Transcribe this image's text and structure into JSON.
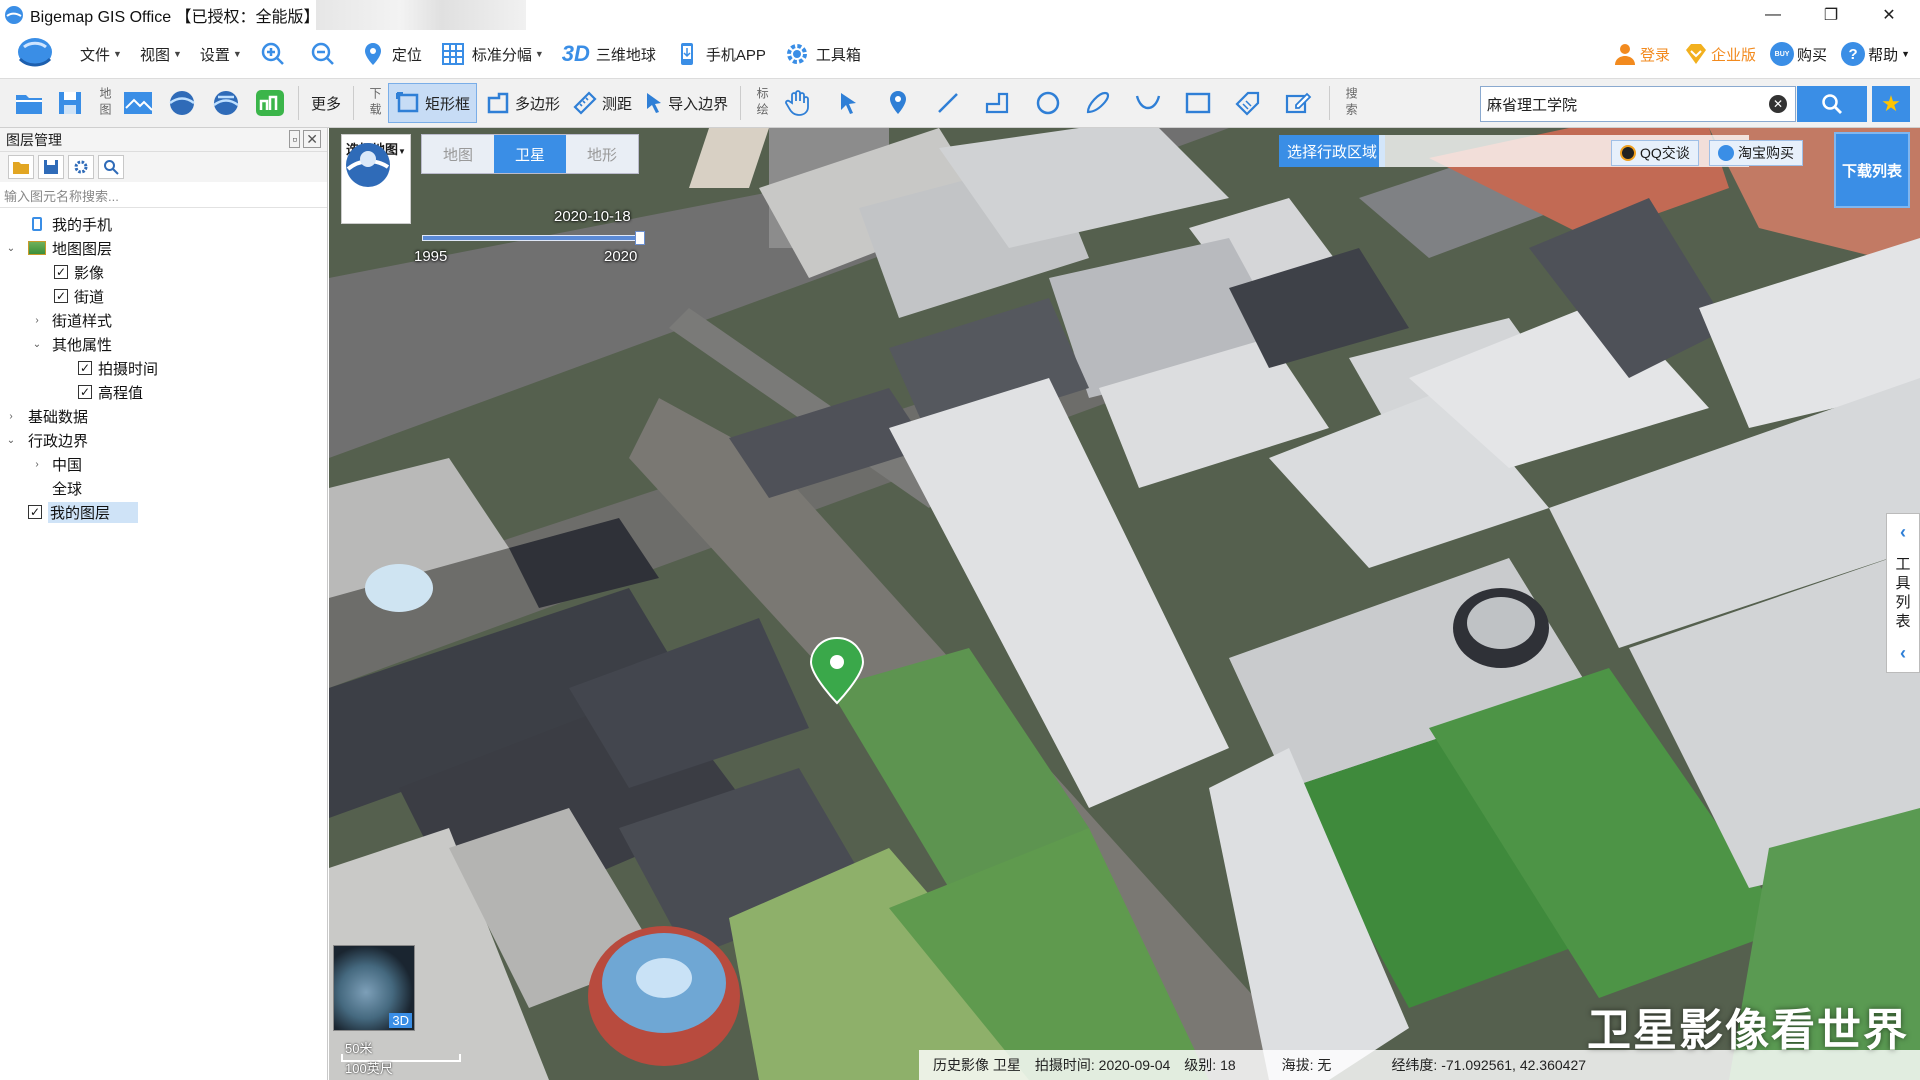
{
  "window": {
    "title": "Bigemap GIS Office 【已授权：全能版】",
    "controls": {
      "minimize": "—",
      "restore": "❐",
      "close": "✕"
    }
  },
  "menubar": {
    "items": [
      {
        "label": "文件",
        "has_caret": true
      },
      {
        "label": "视图",
        "has_caret": true
      },
      {
        "label": "设置",
        "has_caret": true
      }
    ],
    "zoom_in_icon": "zoom-in-icon",
    "zoom_out_icon": "zoom-out-icon",
    "locate": "定位",
    "standard_grid": "标准分幅",
    "three_d_logo": "3D",
    "globe": "三维地球",
    "mobile_app": "手机APP",
    "toolbox": "工具箱",
    "right": {
      "login": "登录",
      "enterprise": "企业版",
      "buy": "购买",
      "buy_badge": "BUY",
      "help": "帮助"
    },
    "accent": "#3a8ee6",
    "orange": "#f28a1e"
  },
  "toolbar": {
    "group_map_label": "地图",
    "more": "更多",
    "group_download_label": "下载",
    "rect": "矩形框",
    "polygon": "多边形",
    "measure": "测距",
    "import_boundary": "导入边界",
    "group_draw_label": "标绘",
    "group_search_label": "搜索",
    "search_value": "麻省理工学院",
    "search_placeholder": ""
  },
  "panel": {
    "title": "图层管理",
    "search_placeholder": "输入图元名称搜索...",
    "tree": [
      {
        "label": "我的手机",
        "level": 1,
        "arrow": "",
        "checkbox": null,
        "icon": "phone-icon"
      },
      {
        "label": "地图图层",
        "level": 0,
        "arrow": "⌄",
        "checkbox": null,
        "icon": "layers-icon"
      },
      {
        "label": "影像",
        "level": 2,
        "arrow": "",
        "checkbox": true
      },
      {
        "label": "街道",
        "level": 2,
        "arrow": "",
        "checkbox": true
      },
      {
        "label": "街道样式",
        "level": 1,
        "arrow": "›",
        "checkbox": null
      },
      {
        "label": "其他属性",
        "level": 1,
        "arrow": "⌄",
        "checkbox": null
      },
      {
        "label": "拍摄时间",
        "level": 3,
        "arrow": "",
        "checkbox": true
      },
      {
        "label": "高程值",
        "level": 3,
        "arrow": "",
        "checkbox": true
      },
      {
        "label": "基础数据",
        "level": 0,
        "arrow": "›",
        "checkbox": null
      },
      {
        "label": "行政边界",
        "level": 0,
        "arrow": "⌄",
        "checkbox": null
      },
      {
        "label": "中国",
        "level": 1,
        "arrow": "›",
        "checkbox": null
      },
      {
        "label": "全球",
        "level": 1,
        "arrow": "",
        "checkbox": null
      },
      {
        "label": "我的图层",
        "level": 1,
        "arrow": "",
        "checkbox": true,
        "selected": true
      }
    ]
  },
  "map": {
    "select_map_label": "选择地图",
    "tabs": [
      {
        "label": "地图",
        "active": false
      },
      {
        "label": "卫星",
        "active": true
      },
      {
        "label": "地形",
        "active": false
      }
    ],
    "timeline": {
      "current_date": "2020-10-18",
      "start_year": "1995",
      "end_year": "2020"
    },
    "region_button": "选择行政区域",
    "qq_button": "QQ交谈",
    "taobao_button": "淘宝购买",
    "download_list": "下载列表",
    "side_tools_label": [
      "工",
      "具",
      "列",
      "表"
    ],
    "mini_badge": "3D",
    "scale_top": "50米",
    "scale_bottom": "100英尺",
    "status": {
      "source": "历史影像 卫星",
      "capture_time": "拍摄时间: 2020-09-04",
      "level": "级别:  18",
      "altitude": "海拔: 无",
      "coords": "经纬度:  -71.092561, 42.360427"
    },
    "watermark": "卫星影像看世界"
  }
}
